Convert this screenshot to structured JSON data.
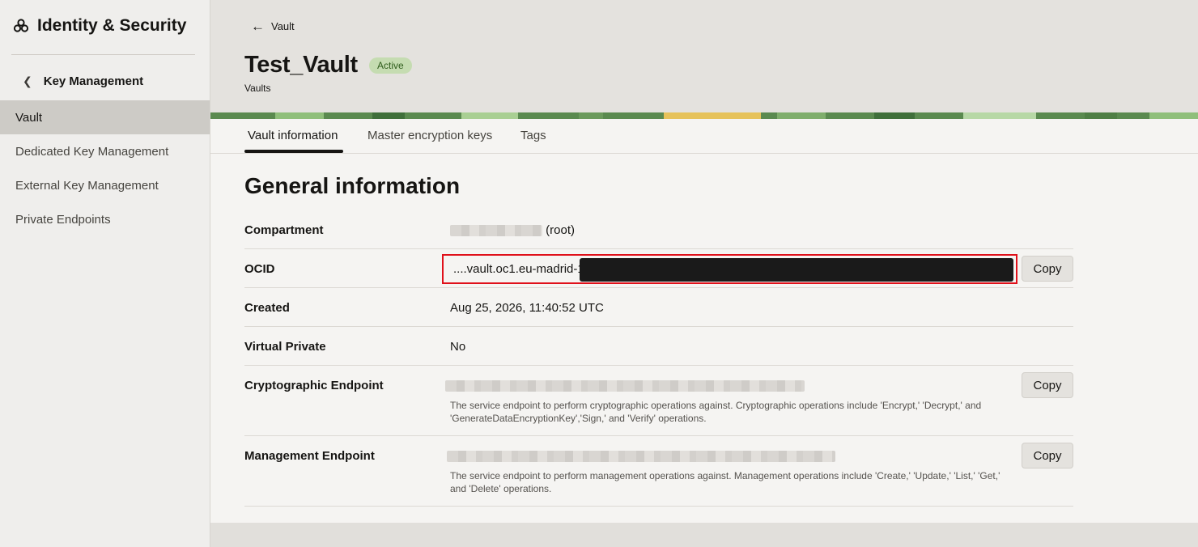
{
  "sidebar": {
    "title": "Identity & Security",
    "back_label": "Key Management",
    "items": [
      {
        "label": "Vault",
        "active": true
      },
      {
        "label": "Dedicated Key Management",
        "active": false
      },
      {
        "label": "External Key Management",
        "active": false
      },
      {
        "label": "Private Endpoints",
        "active": false
      }
    ]
  },
  "header": {
    "back_label": "Vault",
    "title": "Test_Vault",
    "status": "Active",
    "subtitle": "Vaults"
  },
  "tabs": [
    {
      "label": "Vault information",
      "active": true
    },
    {
      "label": "Master encryption keys",
      "active": false
    },
    {
      "label": "Tags",
      "active": false
    }
  ],
  "general": {
    "title": "General information",
    "compartment": {
      "label": "Compartment",
      "suffix": "(root)"
    },
    "ocid": {
      "label": "OCID",
      "value": "....vault.oc1.eu-madrid-1",
      "copy_label": "Copy"
    },
    "created": {
      "label": "Created",
      "value": "Aug 25, 2026, 11:40:52 UTC"
    },
    "virtual_private": {
      "label": "Virtual Private",
      "value": "No"
    },
    "crypto_endpoint": {
      "label": "Cryptographic Endpoint",
      "help": "The service endpoint to perform cryptographic operations against. Cryptographic operations include 'Encrypt,' 'Decrypt,' and 'GenerateDataEncryptionKey','Sign,' and 'Verify' operations.",
      "copy_label": "Copy"
    },
    "mgmt_endpoint": {
      "label": "Management Endpoint",
      "help": "The service endpoint to perform management operations against. Management operations include 'Create,' 'Update,' 'List,' 'Get,' and 'Delete' operations.",
      "copy_label": "Copy"
    }
  },
  "colors": {
    "status_badge_bg": "#c5dcb1",
    "status_badge_text": "#2f5d1c",
    "highlight_border": "#e0101a"
  }
}
